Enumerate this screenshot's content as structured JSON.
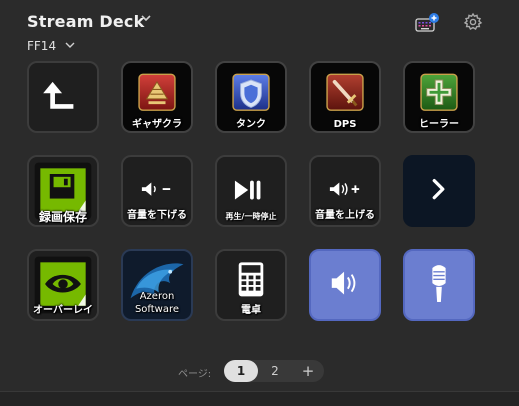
{
  "header": {
    "app_title": "Stream Deck",
    "profile": "FF14"
  },
  "keys": [
    {
      "name": "back",
      "label": ""
    },
    {
      "name": "gatherer",
      "label": "ギャザクラ"
    },
    {
      "name": "tank",
      "label": "タンク"
    },
    {
      "name": "dps",
      "label": "DPS"
    },
    {
      "name": "healer",
      "label": "ヒーラー"
    },
    {
      "name": "record-save",
      "label": "録画保存"
    },
    {
      "name": "volume-down",
      "label": "音量を下げる"
    },
    {
      "name": "play-pause",
      "label": "再生/一時停止"
    },
    {
      "name": "volume-up",
      "label": "音量を上げる"
    },
    {
      "name": "next",
      "label": ""
    },
    {
      "name": "overlay",
      "label": "オーバーレイ"
    },
    {
      "name": "azeron",
      "label_line1": "Azeron",
      "label_line2": "Software"
    },
    {
      "name": "calculator",
      "label": "電卓"
    },
    {
      "name": "volume",
      "label": ""
    },
    {
      "name": "microphone",
      "label": ""
    }
  ],
  "pager": {
    "label": "ページ:",
    "pages": [
      "1",
      "2"
    ],
    "current": "1",
    "add": "+"
  },
  "icons": {
    "title_dropdown": "chevron-down-icon",
    "profile_dropdown": "chevron-down-icon",
    "keyboard": "keyboard-plus-icon",
    "settings": "gear-icon"
  },
  "colors": {
    "background": "#2b2b2b",
    "key_border": "#3c3c3c",
    "blue_key": "#6b7ed0",
    "badge_blue": "#2e7de6",
    "active_page": "#e0e0e0"
  }
}
